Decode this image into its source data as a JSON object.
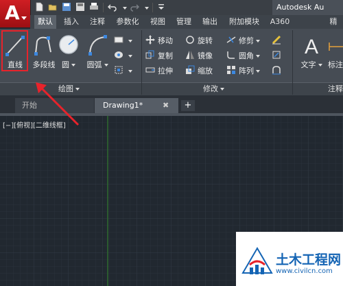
{
  "window": {
    "app_title": "Autodesk Au",
    "qat_icons": [
      "new-icon",
      "open-icon",
      "save-icon",
      "saveas-icon",
      "print-icon",
      "undo-icon",
      "redo-icon",
      "dropdown-icon"
    ]
  },
  "ribbon_tabs": [
    {
      "label": "默认",
      "active": true
    },
    {
      "label": "插入",
      "active": false
    },
    {
      "label": "注释",
      "active": false
    },
    {
      "label": "参数化",
      "active": false
    },
    {
      "label": "视图",
      "active": false
    },
    {
      "label": "管理",
      "active": false
    },
    {
      "label": "输出",
      "active": false
    },
    {
      "label": "附加模块",
      "active": false
    },
    {
      "label": "A360",
      "active": false
    },
    {
      "label": "精",
      "active": false
    }
  ],
  "draw_panel": {
    "title": "绘图",
    "tools": [
      "直线",
      "多段线",
      "圆",
      "圆弧"
    ]
  },
  "modify_panel": {
    "title": "修改",
    "rows": [
      [
        "移动",
        "旋转",
        "修剪"
      ],
      [
        "复制",
        "镜像",
        "圆角"
      ],
      [
        "拉伸",
        "缩放",
        "阵列"
      ]
    ]
  },
  "annotation_panel": {
    "title": "注释",
    "tools": [
      "文字",
      "标注"
    ]
  },
  "document_tabs": {
    "start_label": "开始",
    "drawing_label": "Drawing1*",
    "close_glyph": "✖",
    "add_glyph": "+"
  },
  "viewport_label": "[−][俯视][二维线框]",
  "watermark": {
    "text": "土木工程网",
    "url": "www.civilcn.com"
  },
  "colors": {
    "highlight": "#e8232b",
    "canvas": "#212830",
    "accent": "#1464b4"
  }
}
